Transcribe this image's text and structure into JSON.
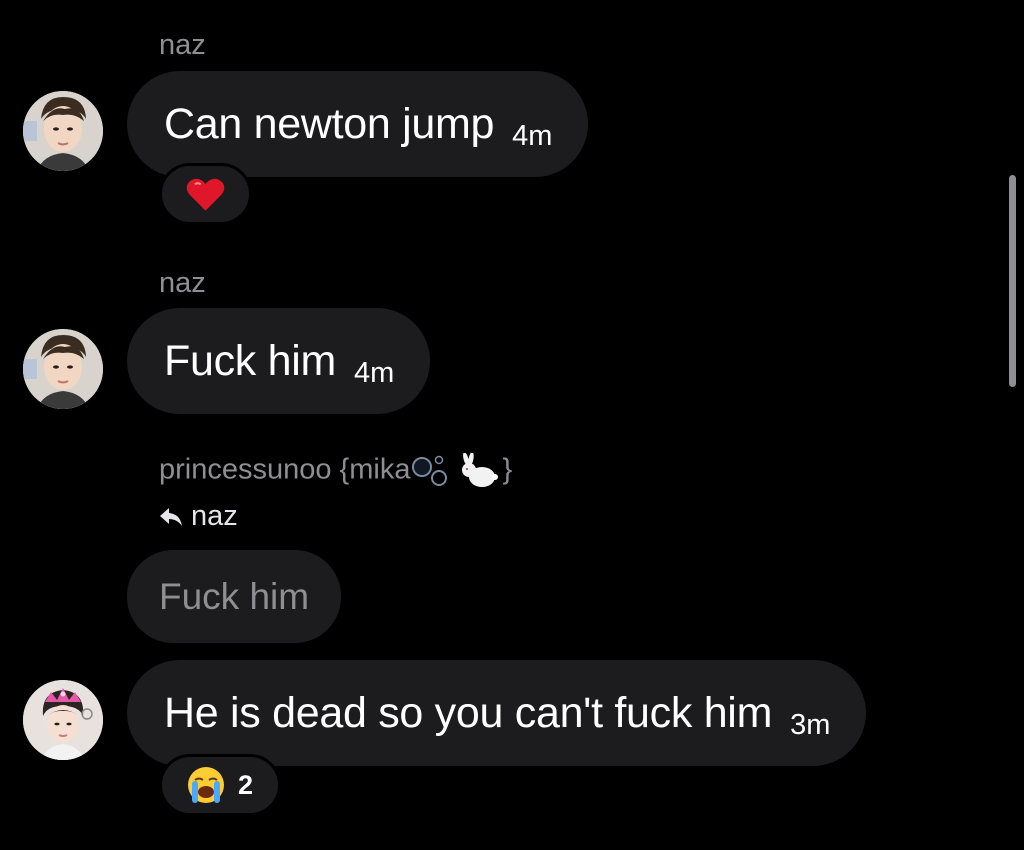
{
  "messages": [
    {
      "sender": "naz",
      "text": "Can newton jump",
      "time": "4m",
      "reaction": {
        "emoji": "heart-icon"
      }
    },
    {
      "sender": "naz",
      "text": "Fuck him",
      "time": "4m"
    },
    {
      "sender": "princessunoo {mika",
      "sender_suffix": "}",
      "reply_to": "naz",
      "quoted_text": "Fuck him",
      "text": "He is dead so you can't fuck him",
      "time": "3m",
      "reaction": {
        "emoji": "loudly-crying-face-icon",
        "count": "2"
      }
    }
  ],
  "colors": {
    "background": "#000000",
    "bubble": "#1c1c1e",
    "secondary_text": "#8e8e93",
    "heart": "#e0162b"
  }
}
